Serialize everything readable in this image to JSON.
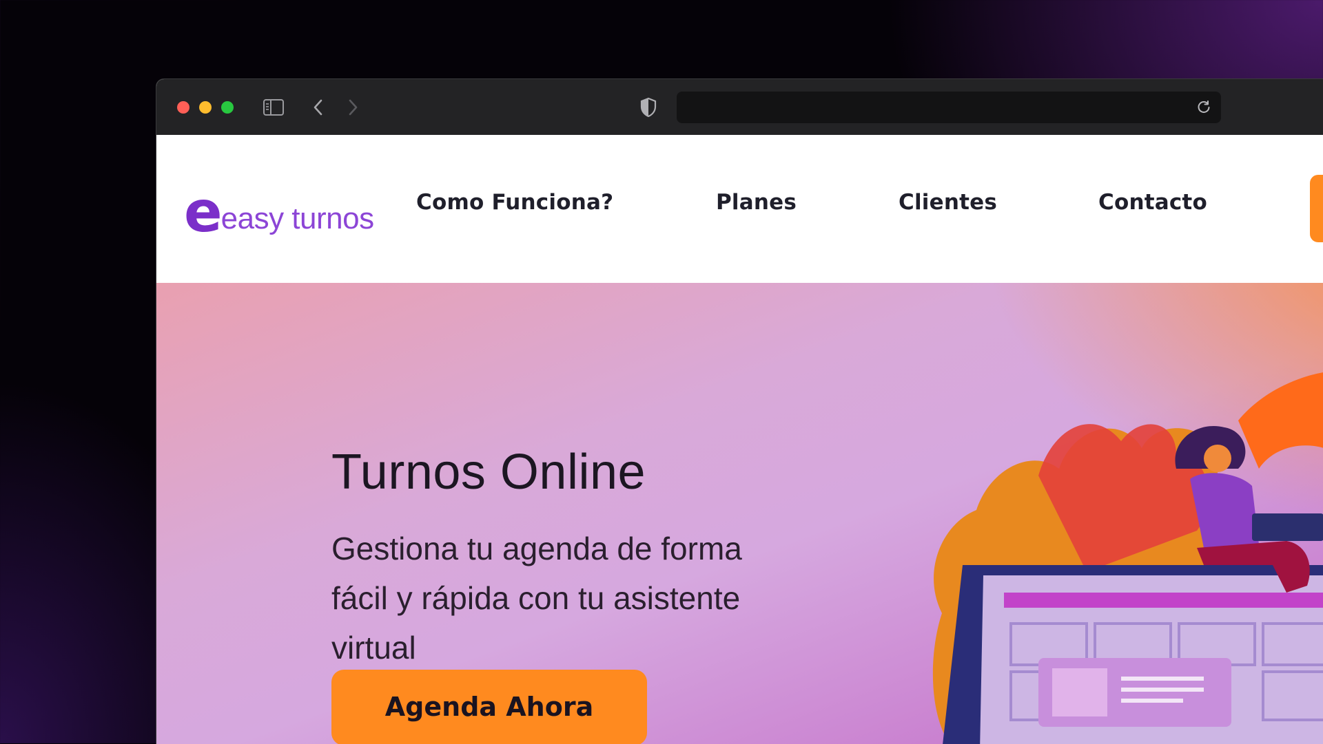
{
  "browser": {
    "icons": {
      "close": "close-dot",
      "minimize": "minimize-dot",
      "zoom": "zoom-dot",
      "sidebar": "sidebar-icon",
      "back": "chevron-left-icon",
      "forward": "chevron-right-icon",
      "privacy": "shield-icon",
      "reload": "reload-icon"
    },
    "address_value": ""
  },
  "site": {
    "logo": {
      "mark": "e",
      "text": "easy turnos"
    },
    "nav": [
      {
        "label": "Como Funciona?"
      },
      {
        "label": "Planes"
      },
      {
        "label": "Clientes"
      },
      {
        "label": "Contacto"
      }
    ],
    "hero": {
      "title": "Turnos Online",
      "subtitle": "Gestiona tu agenda de forma fácil y rápida con tu asistente virtual",
      "cta": "Agenda Ahora"
    }
  },
  "colors": {
    "brand_purple": "#7b2fc9",
    "accent_orange": "#ff8a1f",
    "toolbar": "#232325"
  }
}
